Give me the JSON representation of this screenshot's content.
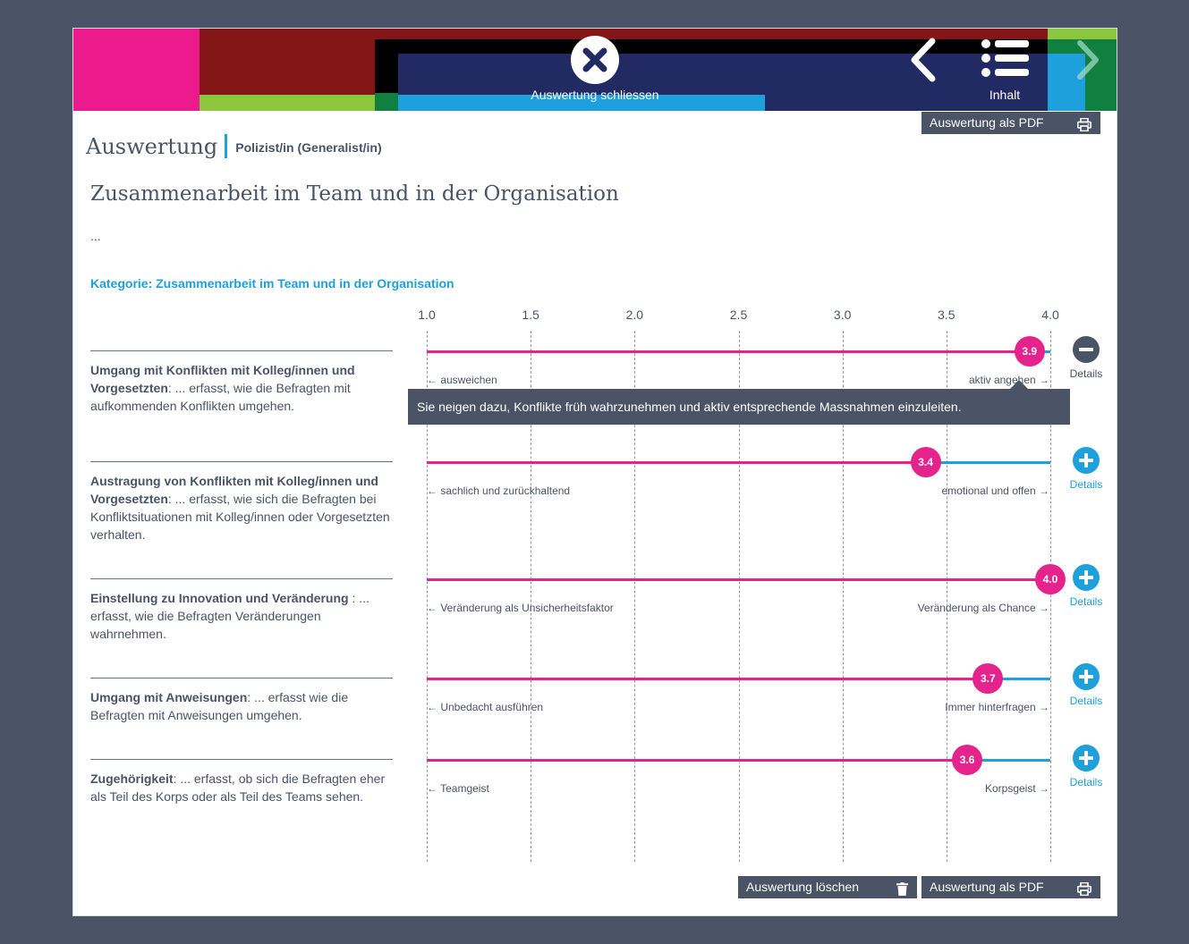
{
  "header": {
    "close_label": "Auswertung schliessen",
    "contents_label": "Inhalt",
    "pdf_label": "Auswertung als PDF",
    "colors": [
      "#ec1a8c",
      "#831517",
      "#8cc63f",
      "#000000",
      "#222a63",
      "#1da0db",
      "#0f8040"
    ]
  },
  "page": {
    "title": "Auswertung",
    "subtitle": "Polizist/in (Generalist/in)",
    "section_title": "Zusammenarbeit im Team und in der Organisation",
    "intro": "...",
    "category": "Kategorie: Zusammenarbeit im Team und in der Organisation"
  },
  "scale": {
    "ticks": [
      "1.0",
      "1.5",
      "2.0",
      "2.5",
      "3.0",
      "3.5",
      "4.0"
    ],
    "min": 1.0,
    "max": 4.0
  },
  "items": [
    {
      "name": "Umgang mit Konflikten mit Kolleg/innen und Vorgesetzten",
      "desc": ": ... erfasst, wie die Befragten mit aufkommenden Konflikten umgehen.",
      "value": 3.9,
      "value_label": "3.9",
      "left_pole": "← ausweichen",
      "right_pole": "aktiv angehen →",
      "details_label": "Details",
      "expanded": true,
      "detail_text": "Sie neigen dazu, Konflikte früh wahrzunehmen und aktiv entsprechende Massnahmen einzuleiten."
    },
    {
      "name": "Austragung von Konflikten mit Kolleg/innen und Vorgesetzten",
      "desc": ": ... erfasst, wie sich die Befragten bei Konfliktsituationen mit Kolleg/innen oder Vorgesetzten verhalten.",
      "value": 3.4,
      "value_label": "3.4",
      "left_pole": "← sachlich und zurückhaltend",
      "right_pole": "emotional und offen →",
      "details_label": "Details",
      "expanded": false
    },
    {
      "name": "Einstellung zu Innovation und Veränderung",
      "desc": " : ... erfasst, wie die Befragten Veränderungen wahrnehmen.",
      "value": 4.0,
      "value_label": "4.0",
      "left_pole": "← Veränderung als Unsicherheitsfaktor",
      "right_pole": "Veränderung als Chance →",
      "details_label": "Details",
      "expanded": false
    },
    {
      "name": "Umgang mit Anweisungen",
      "desc": ": ... erfasst wie die Befragten mit Anweisungen umgehen.",
      "value": 3.7,
      "value_label": "3.7",
      "left_pole": "← Unbedacht ausführen",
      "right_pole": "Immer hinterfragen →",
      "details_label": "Details",
      "expanded": false
    },
    {
      "name": "Zugehörigkeit",
      "desc": ": ... erfasst, ob sich die Befragten eher als Teil des Korps oder als Teil des Teams sehen.",
      "value": 3.6,
      "value_label": "3.6",
      "left_pole": "← Teamgeist",
      "right_pole": "Korpsgeist →",
      "details_label": "Details",
      "expanded": false
    }
  ],
  "footer": {
    "delete_label": "Auswertung löschen",
    "pdf_label": "Auswertung als PDF"
  },
  "colors": {
    "score": "#e5238c",
    "remaining": "#1da0db",
    "accent": "#1da0db",
    "dark": "#4a5466"
  }
}
